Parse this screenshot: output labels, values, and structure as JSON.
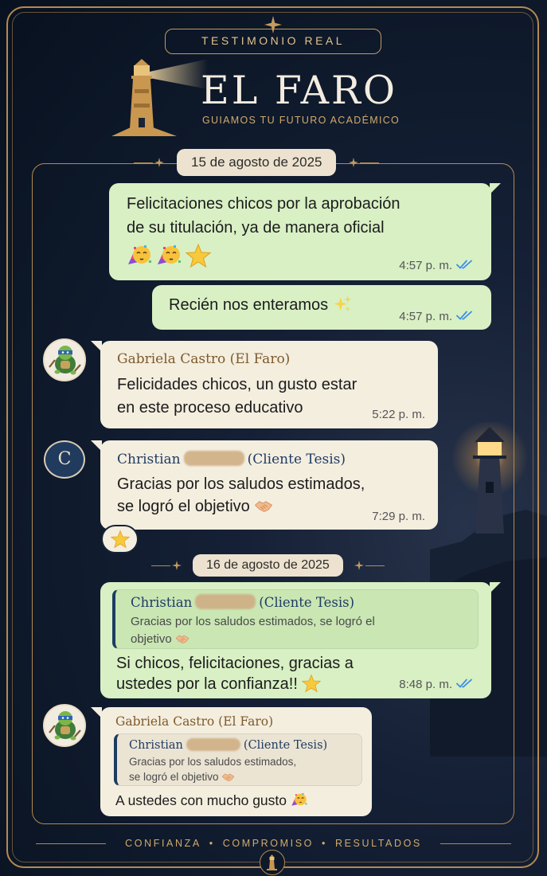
{
  "header": {
    "badge": "TESTIMONIO REAL",
    "brand_name": "EL FARO",
    "tagline": "GUIAMOS TU FUTURO ACADÉMICO"
  },
  "colors": {
    "gold": "#b5894e",
    "navy_bg": "#0d1829",
    "outgoing_bubble": "#d8f0c4",
    "incoming_bubble": "#f4eedf",
    "read_ticks": "#3d8ee8"
  },
  "chat": {
    "date1": "15 de agosto de 2025",
    "date2": "16 de agosto de 2025",
    "m1": {
      "line1": "Felicitaciones chicos por la aprobación",
      "line2": "de su titulación, ya de manera oficial",
      "emojis": [
        "partying-face-emoji",
        "partying-face-emoji",
        "star-emoji"
      ],
      "time": "4:57 p. m.",
      "status": "read-double-check-icon"
    },
    "m2": {
      "text": "Recién nos enteramos",
      "emoji": "sparkles-emoji",
      "time": "4:57 p. m.",
      "status": "read-double-check-icon"
    },
    "m3": {
      "sender": "Gabriela Castro (El Faro)",
      "avatar": "turtle-avatar",
      "line1": "Felicidades chicos, un gusto estar",
      "line2": "en este proceso educativo",
      "time": "5:22 p. m."
    },
    "m4": {
      "avatar_letter": "C",
      "sender_first": "Christian",
      "sender_suffix": "(Cliente Tesis)",
      "line1": "Gracias por los saludos estimados,",
      "line2": "se logró el objetivo",
      "emoji": "handshake-emoji",
      "time": "7:29 p. m.",
      "reaction": "star-emoji"
    },
    "m5": {
      "quote_first": "Christian",
      "quote_suffix": "(Cliente Tesis)",
      "quote_line1": "Gracias por los saludos estimados, se logró el",
      "quote_line2": "objetivo",
      "line1": "Si chicos, felicitaciones, gracias a",
      "line2": "ustedes por la confianza!!",
      "emoji": "star-emoji",
      "time": "8:48 p. m.",
      "status": "read-double-check-icon"
    },
    "m6": {
      "sender": "Gabriela Castro (El Faro)",
      "avatar": "turtle-avatar",
      "quote_first": "Christian",
      "quote_suffix": "(Cliente Tesis)",
      "quote_line1": "Gracias por los saludos estimados,",
      "quote_line2": "se logró el objetivo",
      "text": "A ustedes con mucho gusto",
      "emoji": "partying-face-emoji"
    }
  },
  "footer": {
    "w1": "CONFIANZA",
    "w2": "COMPROMISO",
    "w3": "RESULTADOS",
    "separator": "•"
  }
}
